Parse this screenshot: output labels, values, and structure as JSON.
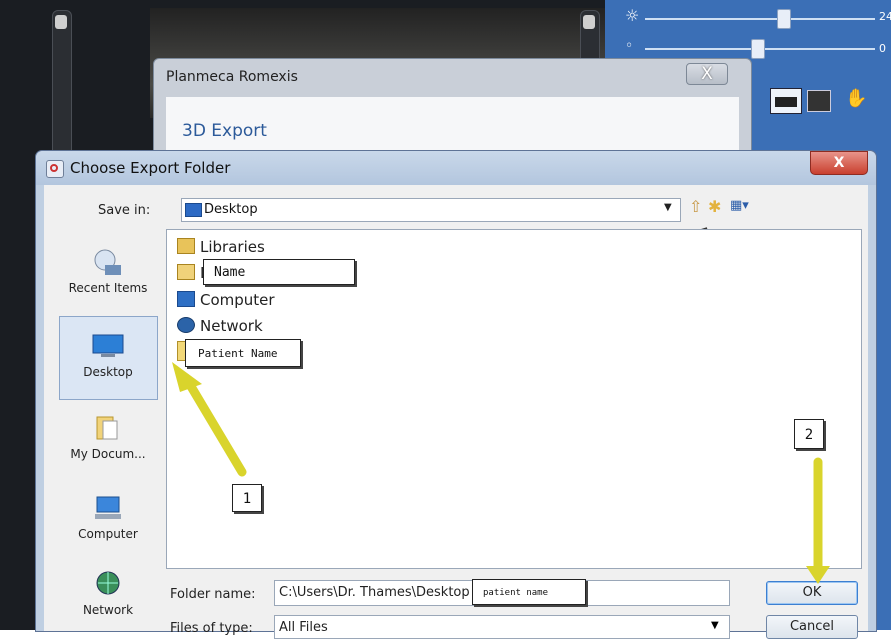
{
  "background_app": {
    "slider_values": [
      "24",
      "0"
    ]
  },
  "romexis_dialog": {
    "title": "Planmeca Romexis",
    "close": "X",
    "section_title": "3D Export"
  },
  "dialog": {
    "title": "Choose Export Folder",
    "close": "X",
    "save_in_label": "Save in:",
    "save_in_value": "Desktop",
    "places": [
      {
        "label": "Recent Items",
        "icon": "recent-items-icon"
      },
      {
        "label": "Desktop",
        "icon": "desktop-icon"
      },
      {
        "label": "My Docum...",
        "icon": "documents-icon"
      },
      {
        "label": "Computer",
        "icon": "computer-icon"
      },
      {
        "label": "Network",
        "icon": "network-icon"
      }
    ],
    "files": [
      {
        "label": "Libraries",
        "icon": "libraries-icon"
      },
      {
        "label": "D",
        "icon": "user-folder-icon"
      },
      {
        "label": "Computer",
        "icon": "computer-icon"
      },
      {
        "label": "Network",
        "icon": "network-icon"
      },
      {
        "label": "",
        "icon": "folder-icon"
      }
    ],
    "folder_name_label": "Folder name:",
    "folder_name_value": "C:\\Users\\Dr. Thames\\Desktop",
    "files_of_type_label": "Files of type:",
    "files_of_type_value": "All Files",
    "ok_label": "OK",
    "cancel_label": "Cancel"
  },
  "annotations": {
    "callout_name": "Name",
    "callout_patient_name": "Patient Name",
    "callout_patient_name_lower": "patient name",
    "step1": "1",
    "step2": "2",
    "arrow_color": "#e6e640"
  }
}
